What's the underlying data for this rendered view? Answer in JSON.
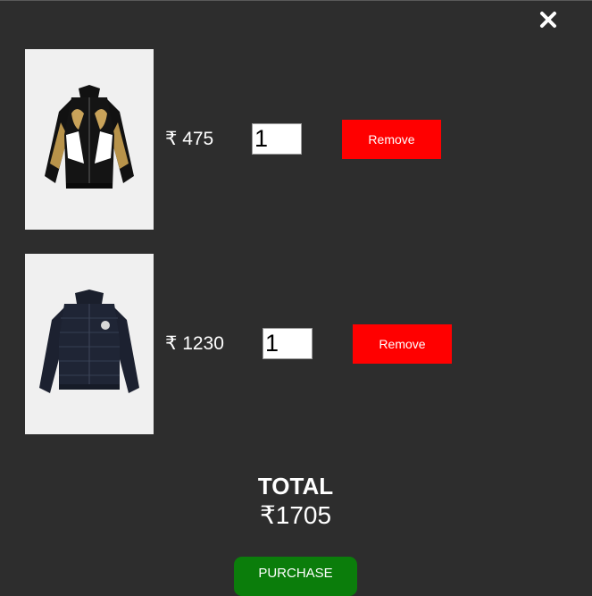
{
  "modal": {
    "close_icon": "close-icon"
  },
  "cart": {
    "items": [
      {
        "image_icon": "track-jacket-image",
        "price": "₹ 475",
        "quantity": "1",
        "remove_label": "Remove"
      },
      {
        "image_icon": "puffer-jacket-image",
        "price": "₹ 1230",
        "quantity": "1",
        "remove_label": "Remove"
      }
    ]
  },
  "summary": {
    "total_label": "TOTAL",
    "total_value": "₹1705",
    "purchase_label": "PURCHASE"
  },
  "colors": {
    "background": "#2d2d2d",
    "remove_button": "#ff0000",
    "purchase_button": "#0b7d0b",
    "text": "#ffffff"
  }
}
